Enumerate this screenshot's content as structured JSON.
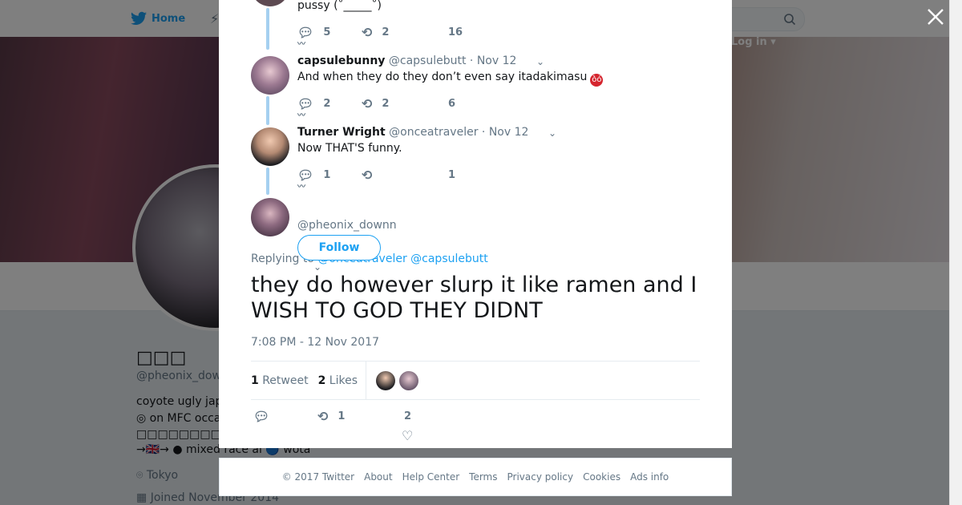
{
  "topnav": {
    "home_label": "Home",
    "login_label": "Log in ▾"
  },
  "profile": {
    "name": "□□□",
    "handle": "@pheonix_dow",
    "bio_lines": [
      "coyote ugly jap",
      "◎ on MFC occa",
      "□□□□□□□□□□□□□□□",
      "→🇬🇧→ ●  mixed race ai 🔵 wota"
    ],
    "location": "Tokyo",
    "joined": "Joined November 2014"
  },
  "thread": {
    "top_reply": {
      "text": "pussy (˚_____˚)",
      "replies": "5",
      "retweets": "2",
      "likes": "16"
    },
    "capsule": {
      "name": "capsulebunny",
      "handle": "@capsulebutt",
      "dot": "·",
      "date": "Nov 12",
      "text": "And when they do they don’t even say itadakimasu",
      "replies": "2",
      "retweets": "2",
      "likes": "6"
    },
    "turner": {
      "name": "Turner Wright",
      "handle": "@onceatraveler",
      "dot": "·",
      "date": "Nov 12",
      "text": "Now THAT'S funny.",
      "replies": "1",
      "retweets": "",
      "likes": "1"
    }
  },
  "main_tweet": {
    "handle": "@pheonix_downn",
    "follow_label": "Follow",
    "replying_prefix": "Replying to",
    "mention_1": "@onceatraveler",
    "mention_2": "@capsulebutt",
    "text": "they do however slurp it like ramen and I WISH TO GOD THEY DIDNT",
    "timestamp": "7:08 PM - 12 Nov 2017",
    "retweet_count": "1",
    "retweet_label": "Retweet",
    "like_count": "2",
    "like_label": "Likes",
    "action_retweets": "1",
    "action_likes": "2"
  },
  "footer": {
    "links": [
      "© 2017 Twitter",
      "About",
      "Help Center",
      "Terms",
      "Privacy policy",
      "Cookies",
      "Ads info"
    ]
  },
  "icons": {
    "close": "close-icon",
    "reply": "reply-icon",
    "retweet": "retweet-icon",
    "like": "heart-icon"
  },
  "colors": {
    "accent": "#1da1f2",
    "thread_line": "#a5d0f0",
    "muted": "#657786"
  }
}
